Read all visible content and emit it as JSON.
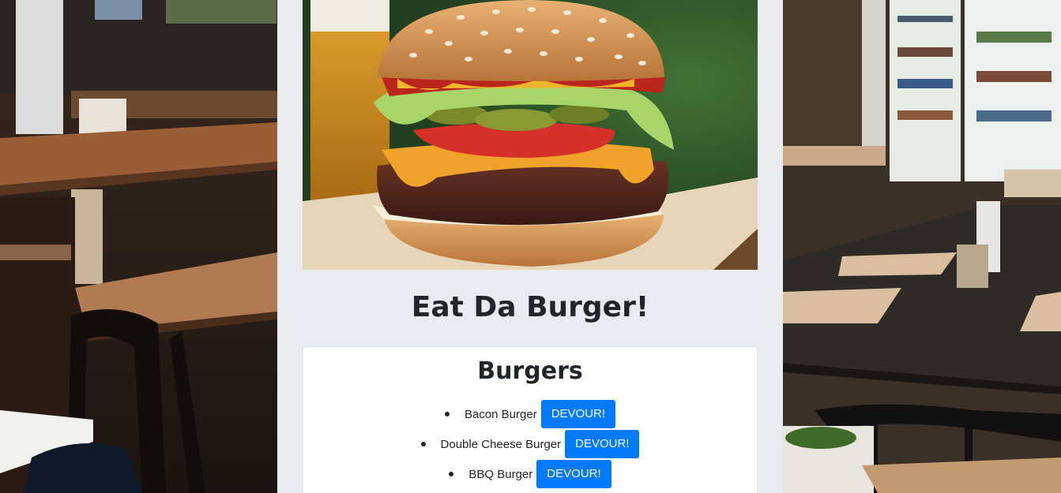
{
  "header": {
    "hero_image": "burger-photo",
    "title": "Eat Da Burger!"
  },
  "burgers_card": {
    "title": "Burgers",
    "items": [
      {
        "name": "Bacon Burger",
        "button_label": "DEVOUR!"
      },
      {
        "name": "Double Cheese Burger",
        "button_label": "DEVOUR!"
      },
      {
        "name": "BBQ Burger",
        "button_label": "DEVOUR!"
      }
    ]
  },
  "background": {
    "image": "restaurant-interior-photo"
  },
  "colors": {
    "page_panel": "#e9ecef",
    "button": "#007bff",
    "text": "#212529"
  }
}
